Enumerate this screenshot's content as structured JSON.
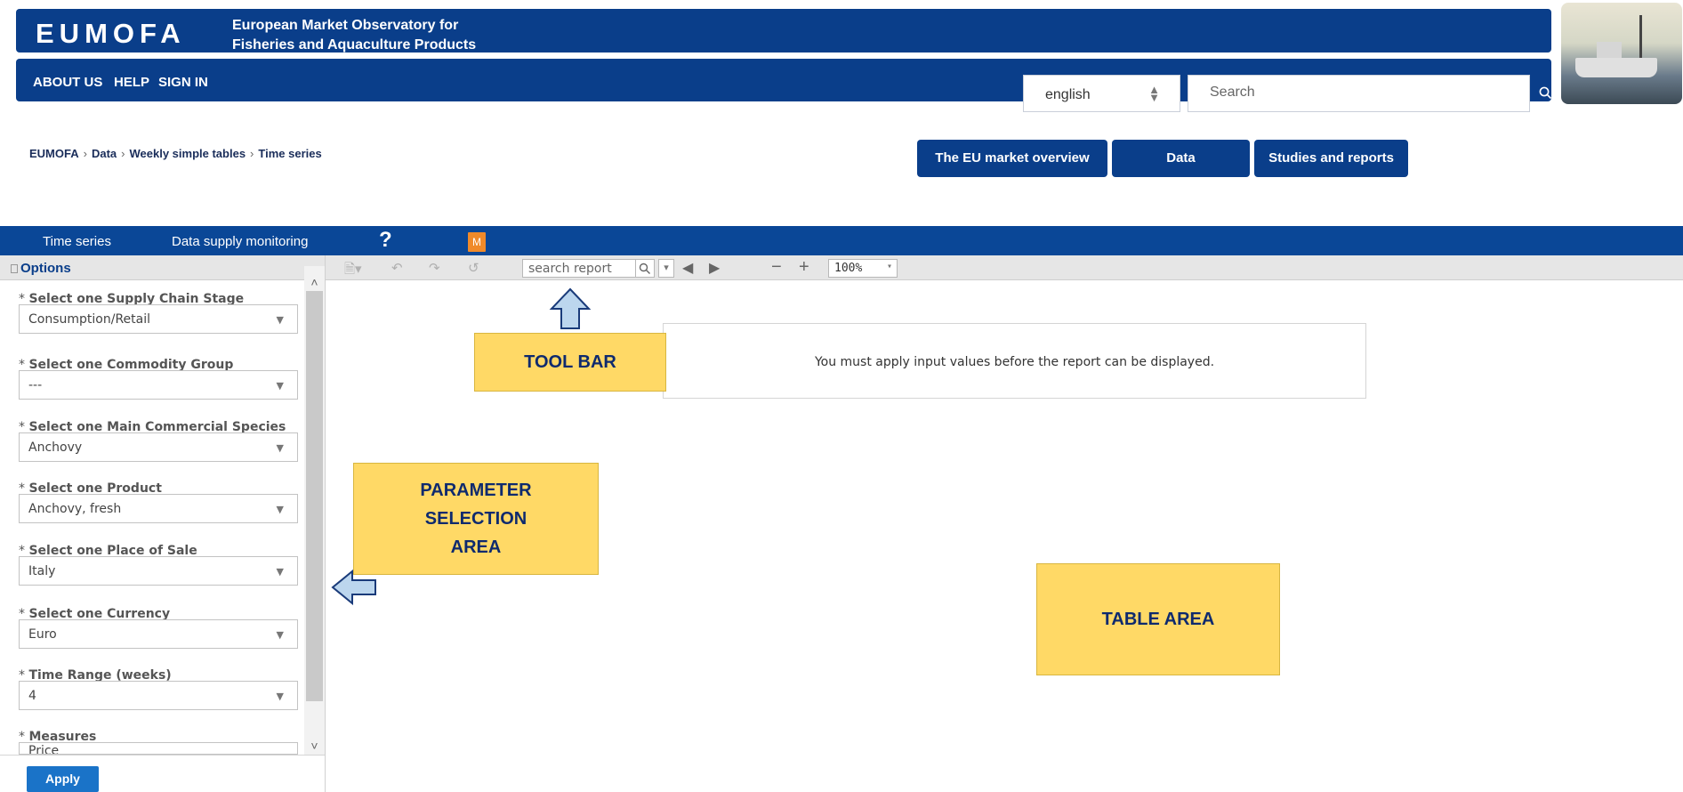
{
  "header": {
    "logo": "EUMOFA",
    "subtitle_line1": "European Market Observatory for",
    "subtitle_line2": "Fisheries and Aquaculture Products"
  },
  "nav": {
    "about": "ABOUT US",
    "help": "HELP",
    "sign_in": "SIGN IN",
    "language": "english",
    "search_placeholder": "Search"
  },
  "breadcrumb": [
    "EUMOFA",
    "Data",
    "Weekly simple tables",
    "Time series"
  ],
  "pills": [
    "The EU market overview",
    "Data",
    "Studies and reports"
  ],
  "report_tabs": {
    "time_series": "Time series",
    "data_supply": "Data supply monitoring",
    "help": "?",
    "m_label": "M"
  },
  "toolbar": {
    "options_label": "Options",
    "search_report": "search report",
    "zoom": "100%"
  },
  "parameters": [
    {
      "label": "Select one Supply Chain Stage",
      "value": "Consumption/Retail"
    },
    {
      "label": "Select one Commodity Group",
      "value": "---"
    },
    {
      "label": "Select one Main Commercial Species",
      "value": "Anchovy"
    },
    {
      "label": "Select one Product",
      "value": "Anchovy, fresh"
    },
    {
      "label": "Select one Place of Sale",
      "value": "Italy"
    },
    {
      "label": "Select one Currency",
      "value": "Euro"
    },
    {
      "label": "Time Range (weeks)",
      "value": "4"
    },
    {
      "label": "Measures",
      "value": "Price"
    }
  ],
  "apply_label": "Apply",
  "report_message": "You must apply input values before the report can be displayed.",
  "annotations": {
    "tool_bar": "TOOL BAR",
    "param_line1": "PARAMETER",
    "param_line2": "SELECTION",
    "param_line3": "AREA",
    "table_area": "TABLE AREA"
  },
  "colors": {
    "brand_blue": "#0a3e8a",
    "tab_blue": "#0a4797",
    "apply_blue": "#1a73c8",
    "note_yellow": "#ffd966",
    "arrow_fill": "#bcd6ee"
  }
}
